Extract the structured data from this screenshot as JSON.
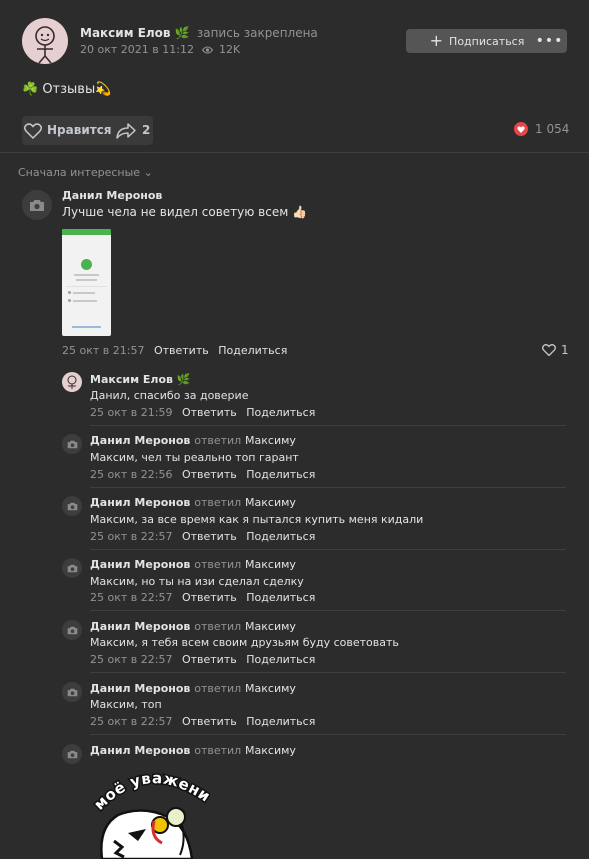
{
  "post": {
    "author": "Максим Елов",
    "author_badge": "🌿",
    "pinned_label": "запись закреплена",
    "date": "20 окт 2021 в 11:12",
    "views": "12K",
    "subscribe_label": "Подписаться",
    "more_label": "•••",
    "text": "☘️ Отзывы💫",
    "like_label": "Нравится",
    "shares": "2",
    "reactions_count": "1 054"
  },
  "comments_sort": "Сначала интересные ⌄",
  "comment": {
    "author": "Данил Меронов",
    "text": "Лучше чела не видел советую всем 👍🏻",
    "date": "25 окт в 21:57",
    "reply_label": "Ответить",
    "share_label": "Поделиться",
    "likes": "1"
  },
  "replies": [
    {
      "author": "Максим Елов",
      "badge": "🌿",
      "replied_word": "",
      "replied_to": "",
      "text": "Данил, спасибо за доверие",
      "date": "25 окт в 21:59",
      "reply_label": "Ответить",
      "share_label": "Поделиться"
    },
    {
      "author": "Данил Меронов",
      "badge": "",
      "replied_word": "ответил",
      "replied_to": "Максиму",
      "text": "Максим, чел ты реально топ гарант",
      "date": "25 окт в 22:56",
      "reply_label": "Ответить",
      "share_label": "Поделиться"
    },
    {
      "author": "Данил Меронов",
      "badge": "",
      "replied_word": "ответил",
      "replied_to": "Максиму",
      "text": "Максим, за все время как я пытался купить меня кидали",
      "date": "25 окт в 22:57",
      "reply_label": "Ответить",
      "share_label": "Поделиться"
    },
    {
      "author": "Данил Меронов",
      "badge": "",
      "replied_word": "ответил",
      "replied_to": "Максиму",
      "text": "Максим, но ты на изи сделал сделку",
      "date": "25 окт в 22:57",
      "reply_label": "Ответить",
      "share_label": "Поделиться"
    },
    {
      "author": "Данил Меронов",
      "badge": "",
      "replied_word": "ответил",
      "replied_to": "Максиму",
      "text": "Максим, я тебя всем своим друзьям буду советовать",
      "date": "25 окт в 22:57",
      "reply_label": "Ответить",
      "share_label": "Поделиться"
    },
    {
      "author": "Данил Меронов",
      "badge": "",
      "replied_word": "ответил",
      "replied_to": "Максиму",
      "text": "Максим, топ",
      "date": "25 окт в 22:57",
      "reply_label": "Ответить",
      "share_label": "Поделиться"
    },
    {
      "author": "Данил Меронов",
      "badge": "",
      "replied_word": "ответил",
      "replied_to": "Максиму",
      "text": "",
      "date": "",
      "reply_label": "",
      "share_label": ""
    }
  ],
  "sticker": {
    "caption": "моё уважение"
  },
  "colors": {
    "background": "#2c2c2c",
    "accent_heart": "#e64646",
    "text": "#e1e3e6",
    "muted": "#939393",
    "button": "#555555"
  }
}
